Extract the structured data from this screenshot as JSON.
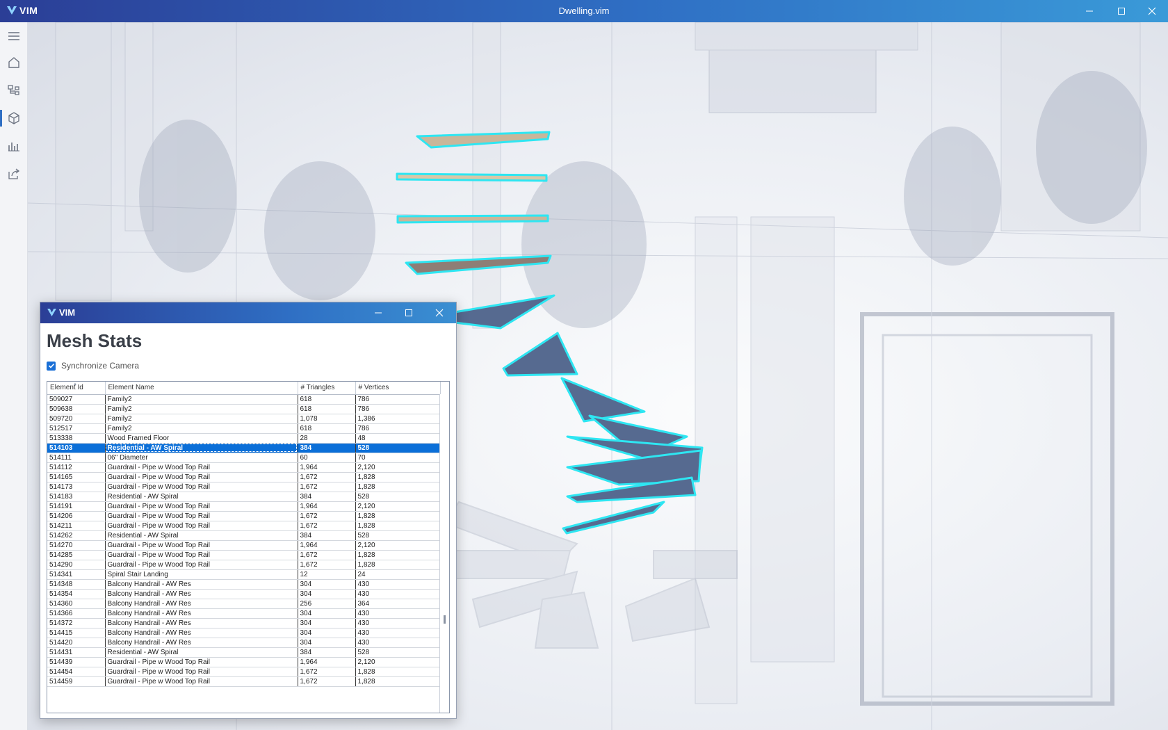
{
  "app": {
    "logo_text": "VIM",
    "window_title": "Dwelling.vim"
  },
  "sidebar": {
    "items": [
      {
        "name": "menu-icon"
      },
      {
        "name": "home-icon"
      },
      {
        "name": "tree-icon"
      },
      {
        "name": "cube-icon",
        "active": true
      },
      {
        "name": "chart-icon"
      },
      {
        "name": "share-icon"
      }
    ]
  },
  "panel": {
    "logo_text": "VIM",
    "title": "Mesh Stats",
    "sync_label": "Synchronize Camera",
    "sync_checked": true,
    "columns": [
      "Element Id",
      "Element Name",
      "# Triangles",
      "# Vertices"
    ],
    "rows": [
      [
        "509027",
        "Family2",
        "618",
        "786"
      ],
      [
        "509638",
        "Family2",
        "618",
        "786"
      ],
      [
        "509720",
        "Family2",
        "1,078",
        "1,386"
      ],
      [
        "512517",
        "Family2",
        "618",
        "786"
      ],
      [
        "513338",
        "Wood Framed Floor",
        "28",
        "48"
      ],
      [
        "514103",
        "Residential - AW Spiral",
        "384",
        "528"
      ],
      [
        "514111",
        "06\" Diameter",
        "60",
        "70"
      ],
      [
        "514112",
        "Guardrail - Pipe w Wood Top Rail",
        "1,964",
        "2,120"
      ],
      [
        "514165",
        "Guardrail - Pipe w Wood Top Rail",
        "1,672",
        "1,828"
      ],
      [
        "514173",
        "Guardrail - Pipe w Wood Top Rail",
        "1,672",
        "1,828"
      ],
      [
        "514183",
        "Residential - AW Spiral",
        "384",
        "528"
      ],
      [
        "514191",
        "Guardrail - Pipe w Wood Top Rail",
        "1,964",
        "2,120"
      ],
      [
        "514206",
        "Guardrail - Pipe w Wood Top Rail",
        "1,672",
        "1,828"
      ],
      [
        "514211",
        "Guardrail - Pipe w Wood Top Rail",
        "1,672",
        "1,828"
      ],
      [
        "514262",
        "Residential - AW Spiral",
        "384",
        "528"
      ],
      [
        "514270",
        "Guardrail - Pipe w Wood Top Rail",
        "1,964",
        "2,120"
      ],
      [
        "514285",
        "Guardrail - Pipe w Wood Top Rail",
        "1,672",
        "1,828"
      ],
      [
        "514290",
        "Guardrail - Pipe w Wood Top Rail",
        "1,672",
        "1,828"
      ],
      [
        "514341",
        "Spiral Stair Landing",
        "12",
        "24"
      ],
      [
        "514348",
        "Balcony Handrail - AW Res",
        "304",
        "430"
      ],
      [
        "514354",
        "Balcony Handrail - AW Res",
        "304",
        "430"
      ],
      [
        "514360",
        "Balcony Handrail - AW Res",
        "256",
        "364"
      ],
      [
        "514366",
        "Balcony Handrail - AW Res",
        "304",
        "430"
      ],
      [
        "514372",
        "Balcony Handrail - AW Res",
        "304",
        "430"
      ],
      [
        "514415",
        "Balcony Handrail - AW Res",
        "304",
        "430"
      ],
      [
        "514420",
        "Balcony Handrail - AW Res",
        "304",
        "430"
      ],
      [
        "514431",
        "Residential - AW Spiral",
        "384",
        "528"
      ],
      [
        "514439",
        "Guardrail - Pipe w Wood Top Rail",
        "1,964",
        "2,120"
      ],
      [
        "514454",
        "Guardrail - Pipe w Wood Top Rail",
        "1,672",
        "1,828"
      ],
      [
        "514459",
        "Guardrail - Pipe w Wood Top Rail",
        "1,672",
        "1,828"
      ]
    ],
    "selected_row": 5
  },
  "colors": {
    "accent": "#2f6fc4",
    "selection": "#0b6fd8",
    "highlight_outline": "#2ee6f2"
  }
}
